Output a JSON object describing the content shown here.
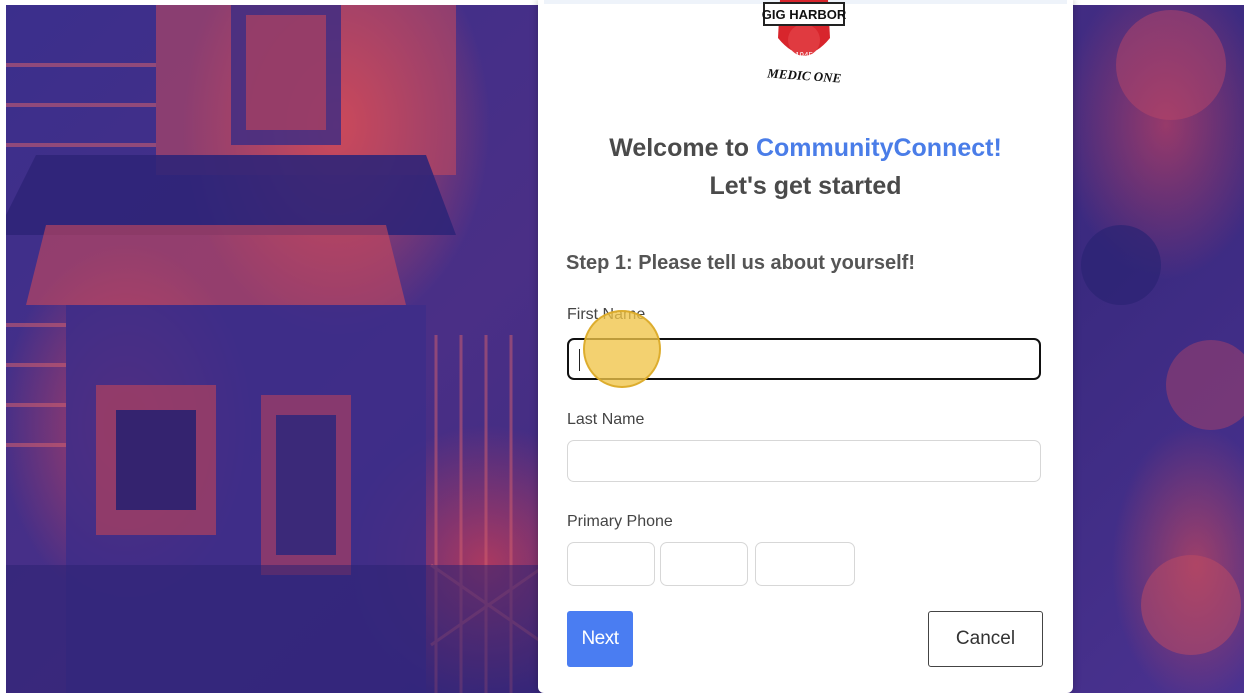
{
  "logo": {
    "top_text": "GIG HARBOR",
    "year": "1945",
    "bottom_text": "MEDIC ONE"
  },
  "welcome": {
    "prefix": "Welcome to ",
    "brand": "CommunityConnect!",
    "subtitle": "Let's get started"
  },
  "step": {
    "title": "Step 1: Please tell us about yourself!"
  },
  "form": {
    "first_name": {
      "label": "First Name",
      "value": ""
    },
    "last_name": {
      "label": "Last Name",
      "value": ""
    },
    "primary_phone": {
      "label": "Primary Phone",
      "area": "",
      "prefix": "",
      "line": ""
    }
  },
  "buttons": {
    "next": "Next",
    "cancel": "Cancel"
  },
  "colors": {
    "brand_blue": "#4a7de8",
    "next_button": "#4a7df2",
    "click_marker": "#f0c448"
  }
}
